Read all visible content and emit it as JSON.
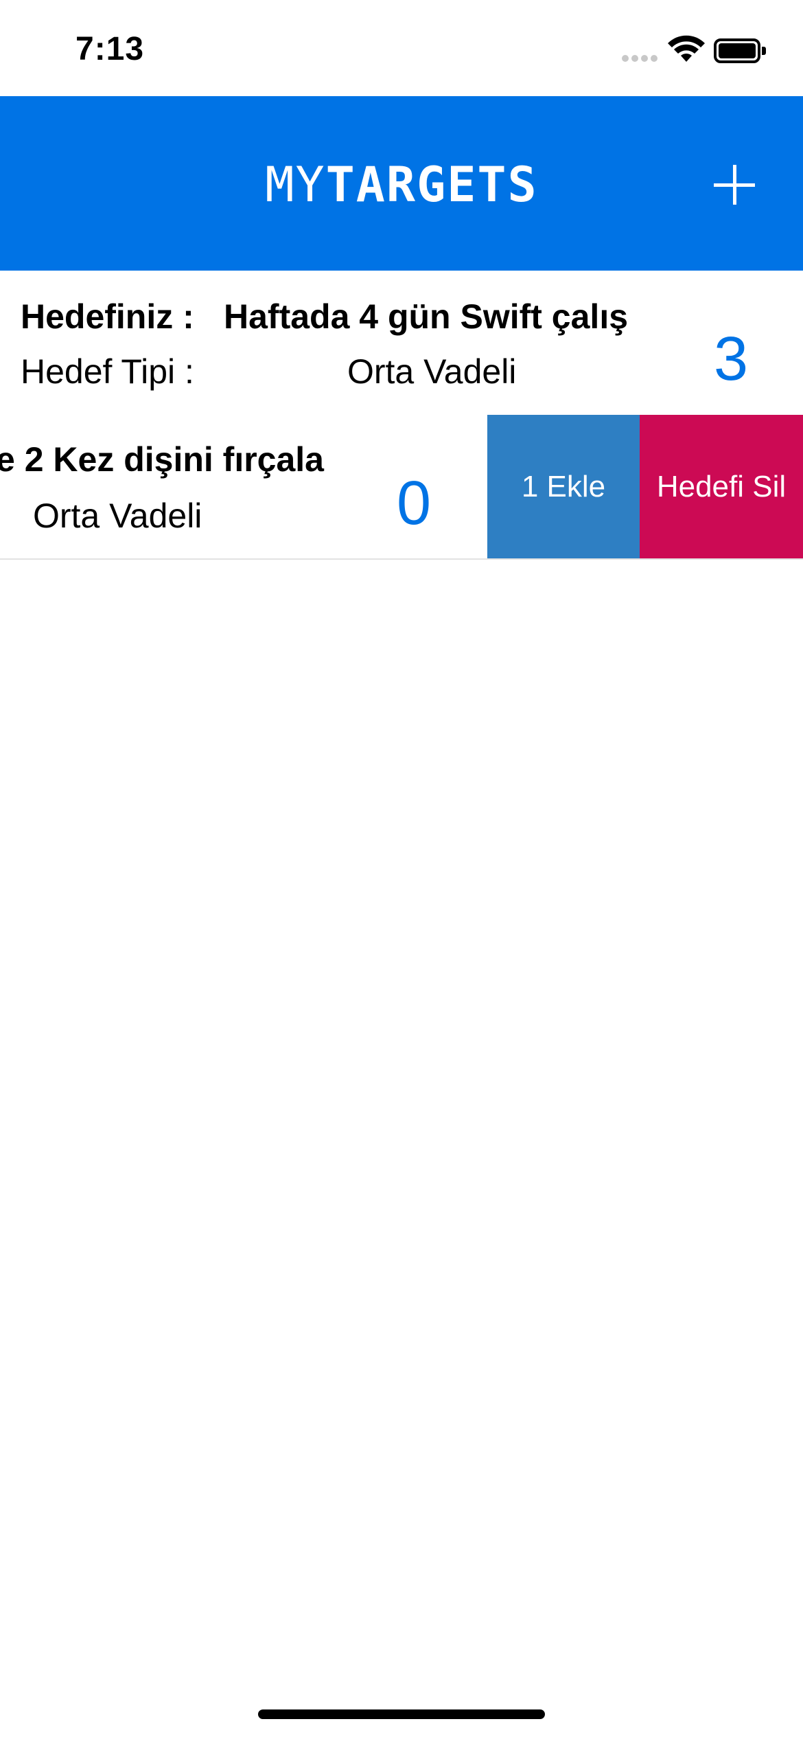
{
  "status_bar": {
    "time": "7:13"
  },
  "nav": {
    "title_prefix": "MY",
    "title_bold": "TARGETS",
    "accent_color": "#0073e5",
    "add_icon": "plus-icon"
  },
  "targets": [
    {
      "target_label": "Hedefiniz :",
      "target_value": "Haftada 4 gün Swift çalış",
      "type_label": "Hedef Tipi :",
      "type_value": "Orta Vadeli",
      "count": "3"
    },
    {
      "target_value": "e 2 Kez dişini fırçala",
      "type_value": "Orta Vadeli",
      "count": "0",
      "swipe_actions": {
        "add_label": "1 Ekle",
        "add_color": "#2e7fc3",
        "delete_label": "Hedefi Sil",
        "delete_color": "#cc0a54"
      }
    }
  ]
}
